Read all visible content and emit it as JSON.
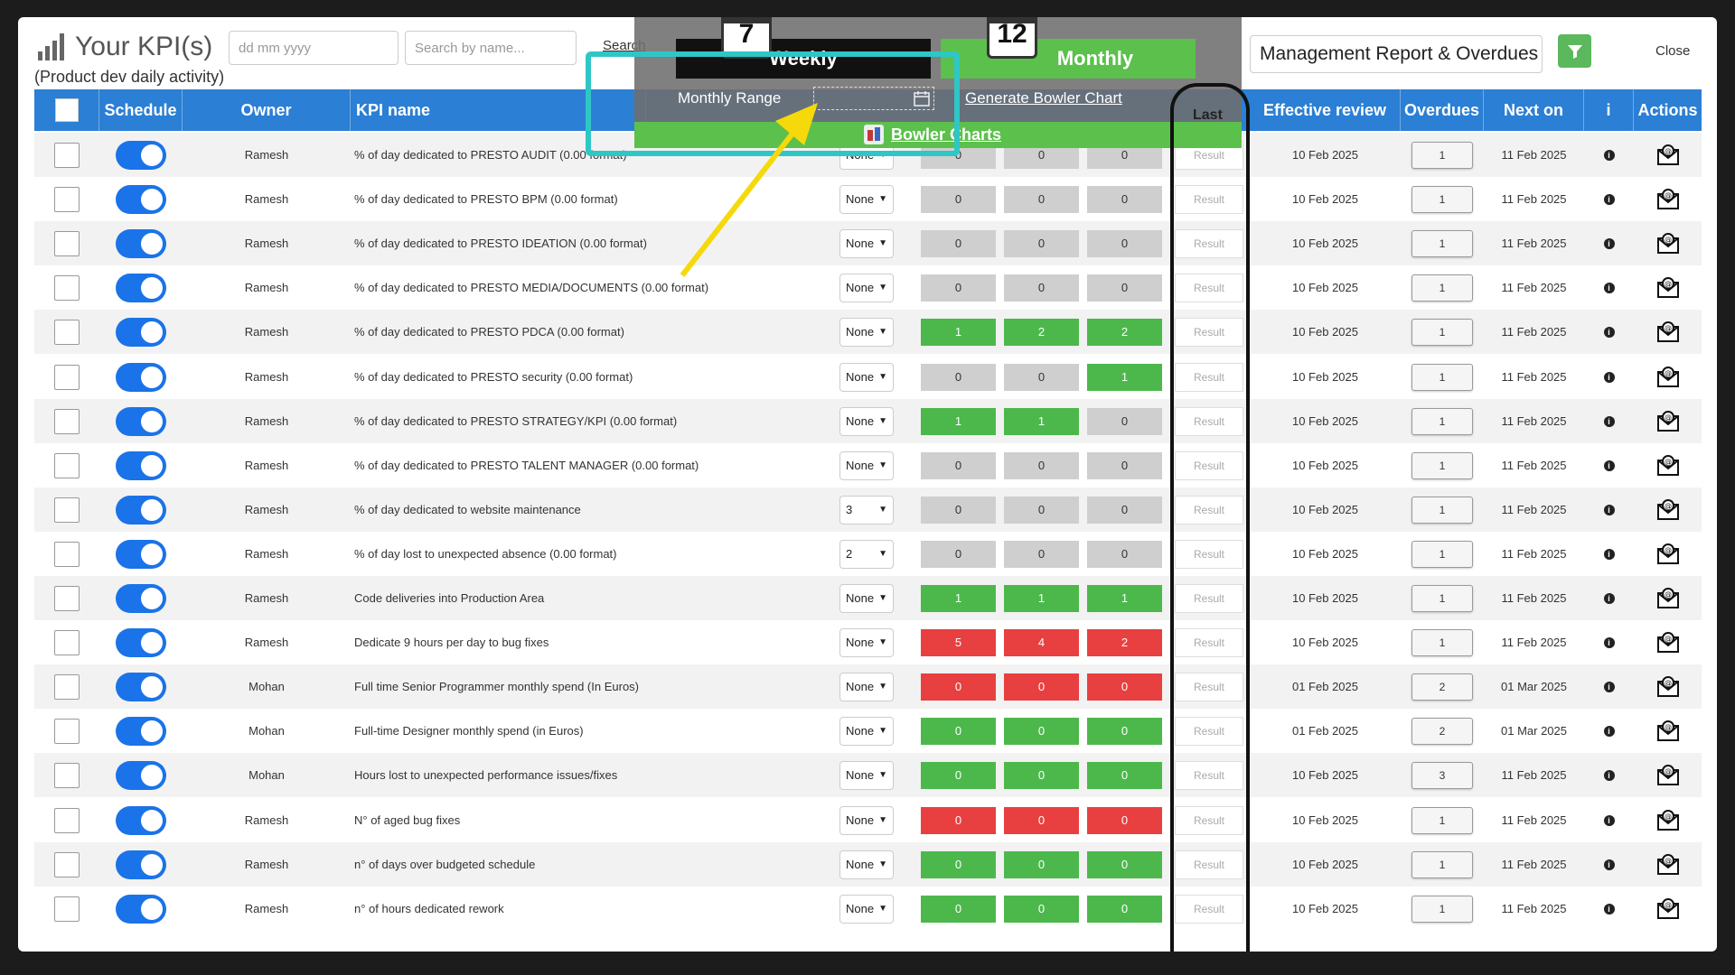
{
  "header": {
    "title": "Your KPI(s)",
    "subtitle": "(Product dev daily activity)",
    "date_placeholder": "dd mm yyyy",
    "search_placeholder": "Search by name...",
    "search_link": "Search",
    "report_select": "Management Report & Overdues",
    "close_label": "Close"
  },
  "overlay": {
    "weekly_label": "Weekly",
    "monthly_label": "Monthly",
    "monthly_icon_number": "12",
    "monthly_range_label": "Monthly Range",
    "generate_label": "Generate Bowler Chart",
    "bowler_charts_label": "Bowler Charts",
    "last_label": "Last"
  },
  "columns": {
    "schedule": "Schedule",
    "owner": "Owner",
    "kpi_name": "KPI name",
    "effective_review": "Effective review",
    "overdues": "Overdues",
    "next_on": "Next on",
    "info": "i",
    "actions": "Actions"
  },
  "colors": {
    "header_blue": "#2b7fd4",
    "green": "#4cb84c",
    "red": "#e84040",
    "gray": "#cfcfcf",
    "toggle_blue": "#1a73e8",
    "highlight_cyan": "#2fc6c6",
    "arrow_yellow": "#f5d90a"
  },
  "result_placeholder": "Result",
  "rows": [
    {
      "owner": "Ramesh",
      "kpi": "% of day dedicated to PRESTO AUDIT (0.00 format)",
      "select": "None",
      "v": [
        [
          "0",
          "gray"
        ],
        [
          "0",
          "gray"
        ],
        [
          "0",
          "gray"
        ]
      ],
      "review": "10 Feb 2025",
      "overdues": "1",
      "next": "11 Feb 2025"
    },
    {
      "owner": "Ramesh",
      "kpi": "% of day dedicated to PRESTO BPM (0.00 format)",
      "select": "None",
      "v": [
        [
          "0",
          "gray"
        ],
        [
          "0",
          "gray"
        ],
        [
          "0",
          "gray"
        ]
      ],
      "review": "10 Feb 2025",
      "overdues": "1",
      "next": "11 Feb 2025"
    },
    {
      "owner": "Ramesh",
      "kpi": "% of day dedicated to PRESTO IDEATION (0.00 format)",
      "select": "None",
      "v": [
        [
          "0",
          "gray"
        ],
        [
          "0",
          "gray"
        ],
        [
          "0",
          "gray"
        ]
      ],
      "review": "10 Feb 2025",
      "overdues": "1",
      "next": "11 Feb 2025"
    },
    {
      "owner": "Ramesh",
      "kpi": "% of day dedicated to PRESTO MEDIA/DOCUMENTS (0.00 format)",
      "select": "None",
      "v": [
        [
          "0",
          "gray"
        ],
        [
          "0",
          "gray"
        ],
        [
          "0",
          "gray"
        ]
      ],
      "review": "10 Feb 2025",
      "overdues": "1",
      "next": "11 Feb 2025"
    },
    {
      "owner": "Ramesh",
      "kpi": "% of day dedicated to PRESTO PDCA (0.00 format)",
      "select": "None",
      "v": [
        [
          "1",
          "green"
        ],
        [
          "2",
          "green"
        ],
        [
          "2",
          "green"
        ]
      ],
      "review": "10 Feb 2025",
      "overdues": "1",
      "next": "11 Feb 2025"
    },
    {
      "owner": "Ramesh",
      "kpi": "% of day dedicated to PRESTO security (0.00 format)",
      "select": "None",
      "v": [
        [
          "0",
          "gray"
        ],
        [
          "0",
          "gray"
        ],
        [
          "1",
          "green"
        ]
      ],
      "review": "10 Feb 2025",
      "overdues": "1",
      "next": "11 Feb 2025"
    },
    {
      "owner": "Ramesh",
      "kpi": "% of day dedicated to PRESTO STRATEGY/KPI (0.00 format)",
      "select": "None",
      "v": [
        [
          "1",
          "green"
        ],
        [
          "1",
          "green"
        ],
        [
          "0",
          "gray"
        ]
      ],
      "review": "10 Feb 2025",
      "overdues": "1",
      "next": "11 Feb 2025"
    },
    {
      "owner": "Ramesh",
      "kpi": "% of day dedicated to PRESTO TALENT MANAGER (0.00 format)",
      "select": "None",
      "v": [
        [
          "0",
          "gray"
        ],
        [
          "0",
          "gray"
        ],
        [
          "0",
          "gray"
        ]
      ],
      "review": "10 Feb 2025",
      "overdues": "1",
      "next": "11 Feb 2025"
    },
    {
      "owner": "Ramesh",
      "kpi": "% of day dedicated to website maintenance",
      "select": "3",
      "v": [
        [
          "0",
          "gray"
        ],
        [
          "0",
          "gray"
        ],
        [
          "0",
          "gray"
        ]
      ],
      "review": "10 Feb 2025",
      "overdues": "1",
      "next": "11 Feb 2025"
    },
    {
      "owner": "Ramesh",
      "kpi": "% of day lost to unexpected absence (0.00 format)",
      "select": "2",
      "v": [
        [
          "0",
          "gray"
        ],
        [
          "0",
          "gray"
        ],
        [
          "0",
          "gray"
        ]
      ],
      "review": "10 Feb 2025",
      "overdues": "1",
      "next": "11 Feb 2025"
    },
    {
      "owner": "Ramesh",
      "kpi": "Code deliveries into Production Area",
      "select": "None",
      "v": [
        [
          "1",
          "green"
        ],
        [
          "1",
          "green"
        ],
        [
          "1",
          "green"
        ]
      ],
      "review": "10 Feb 2025",
      "overdues": "1",
      "next": "11 Feb 2025"
    },
    {
      "owner": "Ramesh",
      "kpi": "Dedicate 9 hours per day to bug fixes",
      "select": "None",
      "v": [
        [
          "5",
          "red"
        ],
        [
          "4",
          "red"
        ],
        [
          "2",
          "red"
        ]
      ],
      "review": "10 Feb 2025",
      "overdues": "1",
      "next": "11 Feb 2025"
    },
    {
      "owner": "Mohan",
      "kpi": "Full time Senior Programmer monthly spend (In Euros)",
      "select": "None",
      "v": [
        [
          "0",
          "red"
        ],
        [
          "0",
          "red"
        ],
        [
          "0",
          "red"
        ]
      ],
      "review": "01 Feb 2025",
      "overdues": "2",
      "next": "01 Mar 2025"
    },
    {
      "owner": "Mohan",
      "kpi": "Full-time Designer monthly spend (in Euros)",
      "select": "None",
      "v": [
        [
          "0",
          "green"
        ],
        [
          "0",
          "green"
        ],
        [
          "0",
          "green"
        ]
      ],
      "review": "01 Feb 2025",
      "overdues": "2",
      "next": "01 Mar 2025"
    },
    {
      "owner": "Mohan",
      "kpi": "Hours lost to unexpected performance issues/fixes",
      "select": "None",
      "v": [
        [
          "0",
          "green"
        ],
        [
          "0",
          "green"
        ],
        [
          "0",
          "green"
        ]
      ],
      "review": "10 Feb 2025",
      "overdues": "3",
      "next": "11 Feb 2025"
    },
    {
      "owner": "Ramesh",
      "kpi": "N° of aged bug fixes",
      "select": "None",
      "v": [
        [
          "0",
          "red"
        ],
        [
          "0",
          "red"
        ],
        [
          "0",
          "red"
        ]
      ],
      "review": "10 Feb 2025",
      "overdues": "1",
      "next": "11 Feb 2025"
    },
    {
      "owner": "Ramesh",
      "kpi": "n° of days over budgeted schedule",
      "select": "None",
      "v": [
        [
          "0",
          "green"
        ],
        [
          "0",
          "green"
        ],
        [
          "0",
          "green"
        ]
      ],
      "review": "10 Feb 2025",
      "overdues": "1",
      "next": "11 Feb 2025"
    },
    {
      "owner": "Ramesh",
      "kpi": "n° of hours dedicated rework",
      "select": "None",
      "v": [
        [
          "0",
          "green"
        ],
        [
          "0",
          "green"
        ],
        [
          "0",
          "green"
        ]
      ],
      "review": "10 Feb 2025",
      "overdues": "1",
      "next": "11 Feb 2025"
    }
  ]
}
